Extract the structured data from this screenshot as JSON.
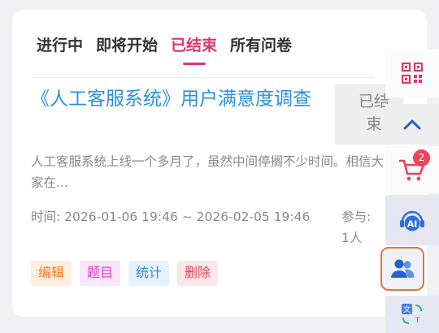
{
  "tabs": [
    {
      "label": "进行中"
    },
    {
      "label": "即将开始"
    },
    {
      "label": "已结束"
    },
    {
      "label": "所有问卷"
    }
  ],
  "active_tab": "已结束",
  "survey": {
    "title": "《人工客服系统》用户满意度调查",
    "description": "人工客服系统上线一个多月了，虽然中间停搁不少时间。相信大家在...",
    "time_label": "时间:",
    "time_range": "2026-01-06 19:46 ~ 2026-02-05 19:46",
    "participants_label": "参与: 1人",
    "status": "已结束"
  },
  "actions": {
    "edit": "编辑",
    "questions": "题目",
    "stats": "统计",
    "delete": "删除"
  },
  "sidebar": {
    "cart_count": "2",
    "ai_label": "AI"
  },
  "colors": {
    "accent": "#e2336a",
    "title_blue": "#2b8fe0",
    "highlight_border": "#e8733c"
  },
  "icons": [
    "qr-code-icon",
    "chevron-up-icon",
    "cart-icon",
    "ai-assistant-icon",
    "users-icon",
    "translate-icon"
  ]
}
